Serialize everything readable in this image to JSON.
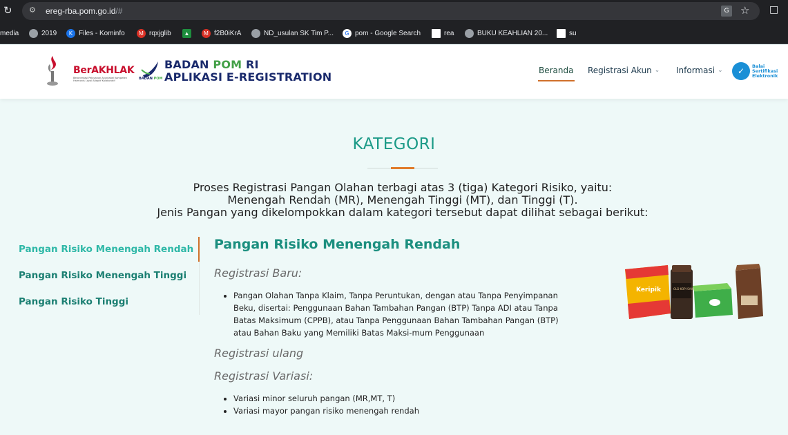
{
  "browser": {
    "url_host": "ereg-rba.pom.go.id",
    "url_path": "/#",
    "bookmarks": [
      {
        "label": "media",
        "color": ""
      },
      {
        "label": "2019",
        "color": "#9aa0a6"
      },
      {
        "label": "Files - Kominfo",
        "color": "#1a73e8"
      },
      {
        "label": "rqxjglib",
        "color": "#d93025"
      },
      {
        "label": "",
        "color": "#1e8e3e"
      },
      {
        "label": "f2B0iKrA",
        "color": "#d93025"
      },
      {
        "label": "ND_usulan SK Tim P...",
        "color": "#9aa0a6"
      },
      {
        "label": "pom - Google Search",
        "color": "#ffffff"
      },
      {
        "label": "rea",
        "color": "#ffffff"
      },
      {
        "label": "BUKU KEAHLIAN 20...",
        "color": "#9aa0a6"
      },
      {
        "label": "su",
        "color": "#ffffff"
      }
    ]
  },
  "header": {
    "berakhlak": "BerAKHLAK",
    "berakhlak_sub": "Berorientasi Pelayanan Akuntabel Kompeten Harmonis Loyal Adaptif Kolaboratif",
    "brand_line1_a": "BADAN ",
    "brand_line1_b": "POM",
    "brand_line1_c": " RI",
    "brand_line2": "APLIKASI E-REGISTRATION",
    "brand_small_a": "BADAN",
    "brand_small_b": " POM",
    "nav": {
      "home": "Beranda",
      "registrasi": "Registrasi Akun",
      "informasi": "Informasi"
    },
    "bsre_line1": "Balai",
    "bsre_line2": "Sertifikasi",
    "bsre_line3": "Elektronik"
  },
  "main": {
    "title": "KATEGORI",
    "intro_line1": "Proses Registrasi Pangan Olahan terbagi atas 3 (tiga) Kategori Risiko, yaitu:",
    "intro_line2": "Menengah Rendah (MR), Menengah Tinggi (MT), dan Tinggi (T).",
    "intro_line3": "Jenis Pangan yang dikelompokkan dalam kategori tersebut dapat dilihat sebagai berikut:",
    "tabs": [
      {
        "label": "Pangan Risiko Menengah Rendah"
      },
      {
        "label": "Pangan Risiko Menengah Tinggi"
      },
      {
        "label": "Pangan Risiko Tinggi"
      }
    ],
    "panel": {
      "title": "Pangan Risiko Menengah Rendah",
      "baru_heading": "Registrasi Baru:",
      "baru_item_lines": [
        "Pangan Olahan Tanpa Klaim, Tanpa Peruntukan, dengan atau Tanpa Penyimpanan",
        "Beku, disertai: Penggunaan Bahan Tambahan Pangan (BTP) Tanpa ADI atau Tanpa",
        "Batas Maksimum (CPPB), atau Tanpa Penggunaan Bahan Tambahan Pangan (BTP)",
        "atau Bahan Baku yang Memiliki Batas Maksi-mum Penggunaan"
      ],
      "ulang_heading": "Registrasi ulang",
      "variasi_heading": "Registrasi Variasi:",
      "variasi_items": [
        "Variasi minor seluruh pangan (MR,MT, T)",
        "Variasi mayor pangan risiko menengah rendah"
      ],
      "product_label": "Keripik",
      "product_jar_label": "OLD KOPI SAHABAT"
    }
  },
  "colors": {
    "accent_teal": "#1b9a87",
    "accent_orange": "#e07b2a",
    "navy": "#1a2a6c"
  }
}
